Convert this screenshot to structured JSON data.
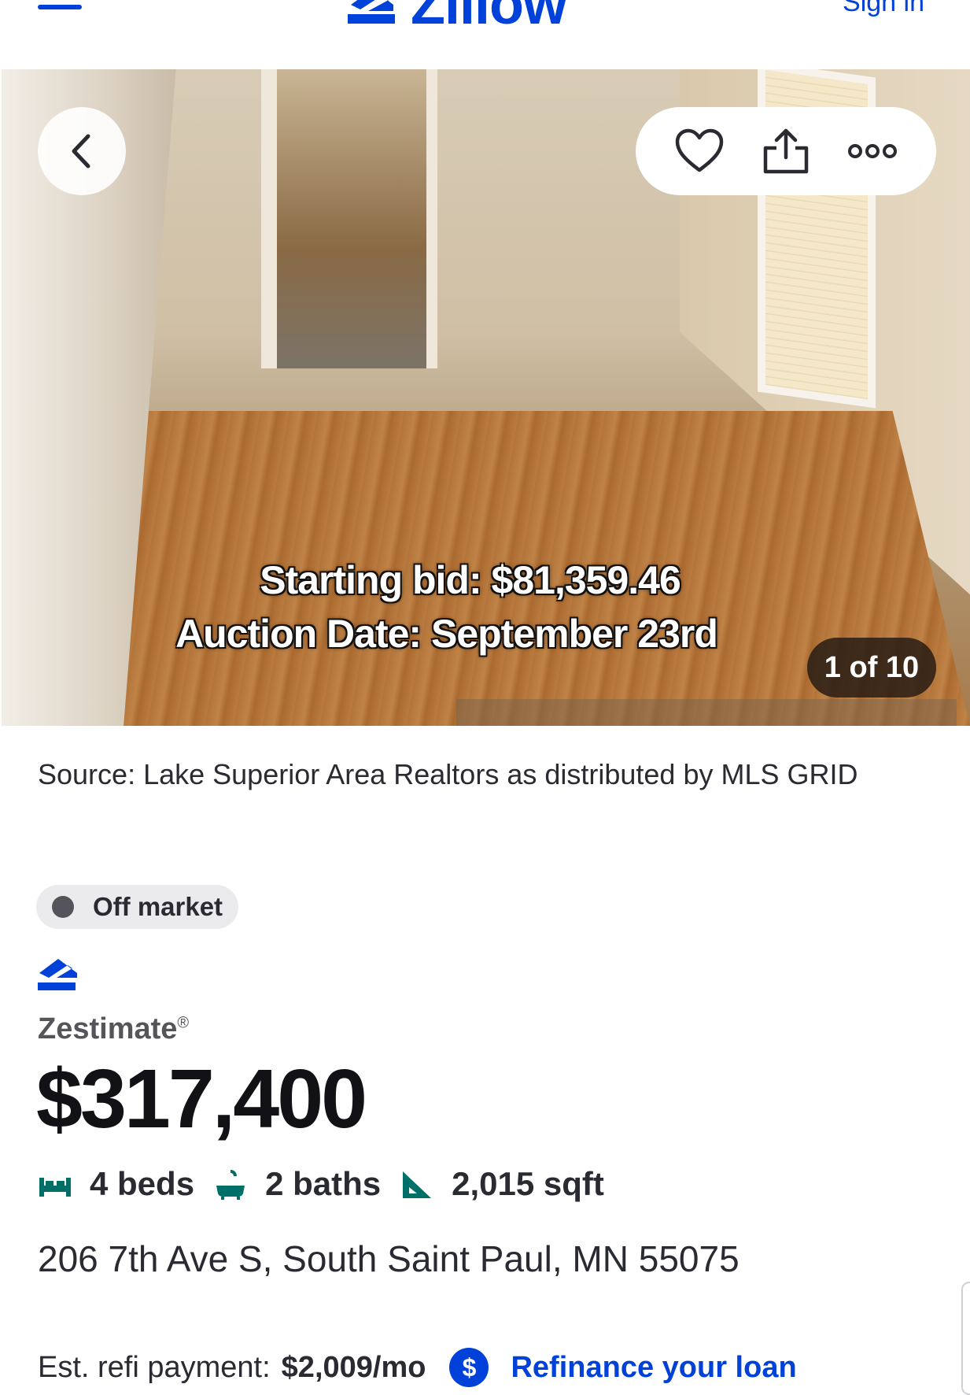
{
  "header": {
    "logo_text": "Zillow",
    "signin_label": "Sign in"
  },
  "photo": {
    "bid_line": "Starting bid: $81,359.46",
    "auction_line": "Auction Date: September 23rd",
    "counter": "1 of 10"
  },
  "listing": {
    "source": "Source: Lake Superior Area Realtors as distributed by MLS GRID",
    "status": "Off market",
    "zestimate_label": "Zestimate",
    "zestimate_reg": "®",
    "zestimate_value": "$317,400",
    "beds": "4 beds",
    "baths": "2 baths",
    "sqft": "2,015 sqft",
    "address": "206 7th Ave S, South Saint Paul, MN 55075"
  },
  "refi": {
    "label": "Est. refi payment:",
    "value": "$2,009/mo",
    "dollar_icon": "$",
    "link": "Refinance your loan"
  },
  "colors": {
    "brand": "#0041d9",
    "text": "#2a2a33",
    "fact_icon": "#006f68"
  }
}
